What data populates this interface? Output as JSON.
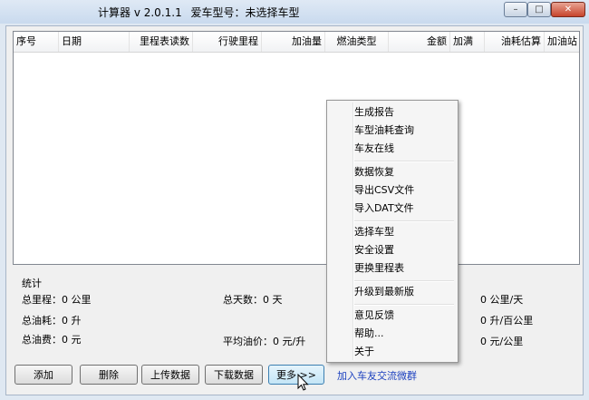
{
  "titlebar": {
    "title_prefix": "计算器 v 2.0.1.1",
    "title_car": "爱车型号：未选择车型",
    "minimize": "–",
    "maximize": "□",
    "close": "✕"
  },
  "table": {
    "columns": [
      "序号",
      "日期",
      "里程表读数",
      "行驶里程",
      "加油量",
      "燃油类型",
      "金额",
      "加满",
      "油耗估算",
      "加油站"
    ]
  },
  "stats": {
    "title": "统计",
    "total_distance": "总里程：0 公里",
    "total_days": "总天数：0 天",
    "avg_daily_distance": "0 公里/天",
    "total_fuel": "总油耗：0 升",
    "avg_consumption": "0 升/百公里",
    "total_cost": "总油费：0 元",
    "avg_price": "平均油价：0 元/升",
    "cost_per_km": "0 元/公里"
  },
  "buttons": {
    "add": "添加",
    "delete": "删除",
    "upload": "上传数据",
    "download": "下载数据",
    "more": "更多 >>",
    "join_group": "加入车友交流微群"
  },
  "menu": {
    "group1": [
      "生成报告",
      "车型油耗查询",
      "车友在线"
    ],
    "group2": [
      "数据恢复",
      "导出CSV文件",
      "导入DAT文件"
    ],
    "group3": [
      "选择车型",
      "安全设置",
      "更换里程表"
    ],
    "group4": [
      "升级到最新版"
    ],
    "group5": [
      "意见反馈",
      "帮助...",
      "关于"
    ]
  }
}
